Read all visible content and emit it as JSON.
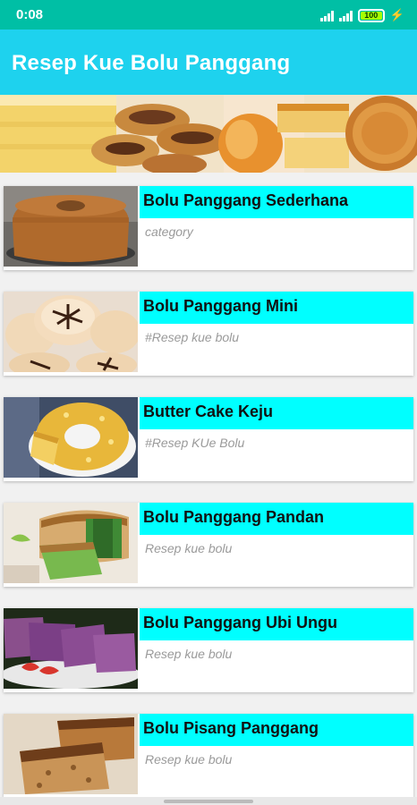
{
  "status": {
    "time": "0:08",
    "battery": "100"
  },
  "app": {
    "title": "Resep Kue Bolu Panggang"
  },
  "banner": {
    "image": "cake-collage"
  },
  "recipes": [
    {
      "title": "Bolu Panggang Sederhana",
      "subtitle": "category"
    },
    {
      "title": "Bolu Panggang Mini",
      "subtitle": "#Resep kue bolu"
    },
    {
      "title": "Butter Cake Keju",
      "subtitle": "#Resep KUe Bolu"
    },
    {
      "title": "Bolu Panggang Pandan",
      "subtitle": "Resep kue bolu"
    },
    {
      "title": "Bolu Panggang Ubi Ungu",
      "subtitle": "Resep kue bolu"
    },
    {
      "title": "Bolu Pisang Panggang",
      "subtitle": "Resep kue bolu"
    }
  ],
  "colors": {
    "status": "#00bfa5",
    "appbar": "#1ed2ee",
    "title_bar": "#00ffff",
    "subtitle": "#9a9a9a"
  }
}
